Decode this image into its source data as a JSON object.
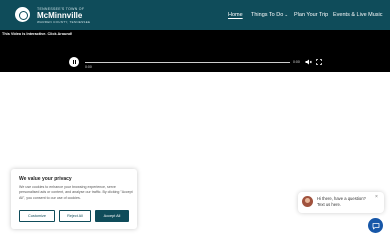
{
  "header": {
    "logo": {
      "small_text": "Tennessee's Town of",
      "name": "McMinnville",
      "tagline": "Warren County, Tennessee",
      "icon": "logo-icon"
    },
    "nav": [
      {
        "label": "Home",
        "active": true
      },
      {
        "label": "Things To Do",
        "has_dropdown": true
      },
      {
        "label": "Plan Your Trip"
      },
      {
        "label": "Events & Live Music"
      }
    ]
  },
  "video": {
    "note": "This Video is Interactive. Click Around!",
    "current_time": "0:00",
    "duration": "0:00",
    "icons": [
      "pause-icon",
      "mute-icon",
      "fullscreen-icon"
    ]
  },
  "cookie": {
    "title": "We value your privacy",
    "text": "We use cookies to enhance your browsing experience, serve personalised ads or content, and analyse our traffic. By clicking \"Accept All\", you consent to our use of cookies.",
    "customize_label": "Customize",
    "reject_label": "Reject All",
    "accept_label": "Accept All"
  },
  "chat": {
    "message": "Hi there, have a question? Text us here.",
    "close_symbol": "×",
    "icons": [
      "avatar",
      "close-icon",
      "chat-icon"
    ]
  },
  "colors": {
    "brand": "#0f4c5a",
    "chat_button": "#1757a8"
  }
}
